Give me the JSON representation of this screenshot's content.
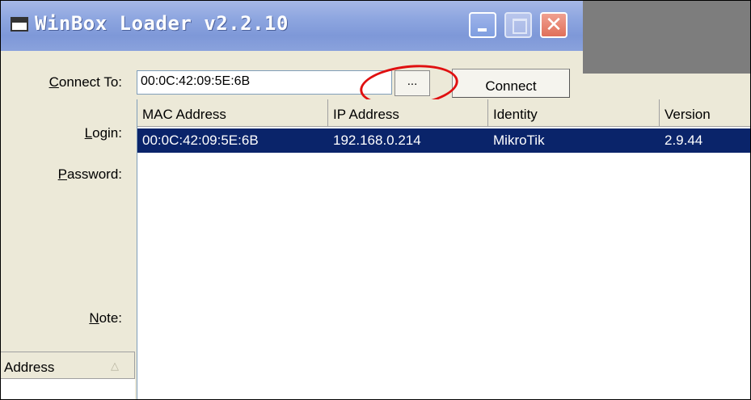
{
  "window": {
    "title": "WinBox Loader v2.2.10",
    "minimize_label": "minimize",
    "maximize_label": "maximize",
    "close_glyph": "✕"
  },
  "form": {
    "connect_to_label": "Connect To:",
    "connect_to_value": "00:0C:42:09:5E:6B",
    "browse_label": "...",
    "connect_label": "Connect",
    "login_label": "Login:",
    "password_label": "Password:",
    "note_label": "Note:"
  },
  "table": {
    "columns": [
      "MAC Address",
      "IP Address",
      "Identity",
      "Version"
    ],
    "rows": [
      {
        "mac": "00:0C:42:09:5E:6B",
        "ip": "192.168.0.214",
        "identity": "MikroTik",
        "version": "2.9.44",
        "selected": true
      }
    ]
  },
  "address_list": {
    "header": "Address",
    "sort_glyph": "△"
  },
  "colors": {
    "selection": "#0a246a",
    "highlight": "#e01010",
    "titlebar": "#8ea6e0"
  },
  "icons": {
    "title_icon": "winbox-window-icon",
    "sort_icon": "sort-ascending-icon"
  }
}
